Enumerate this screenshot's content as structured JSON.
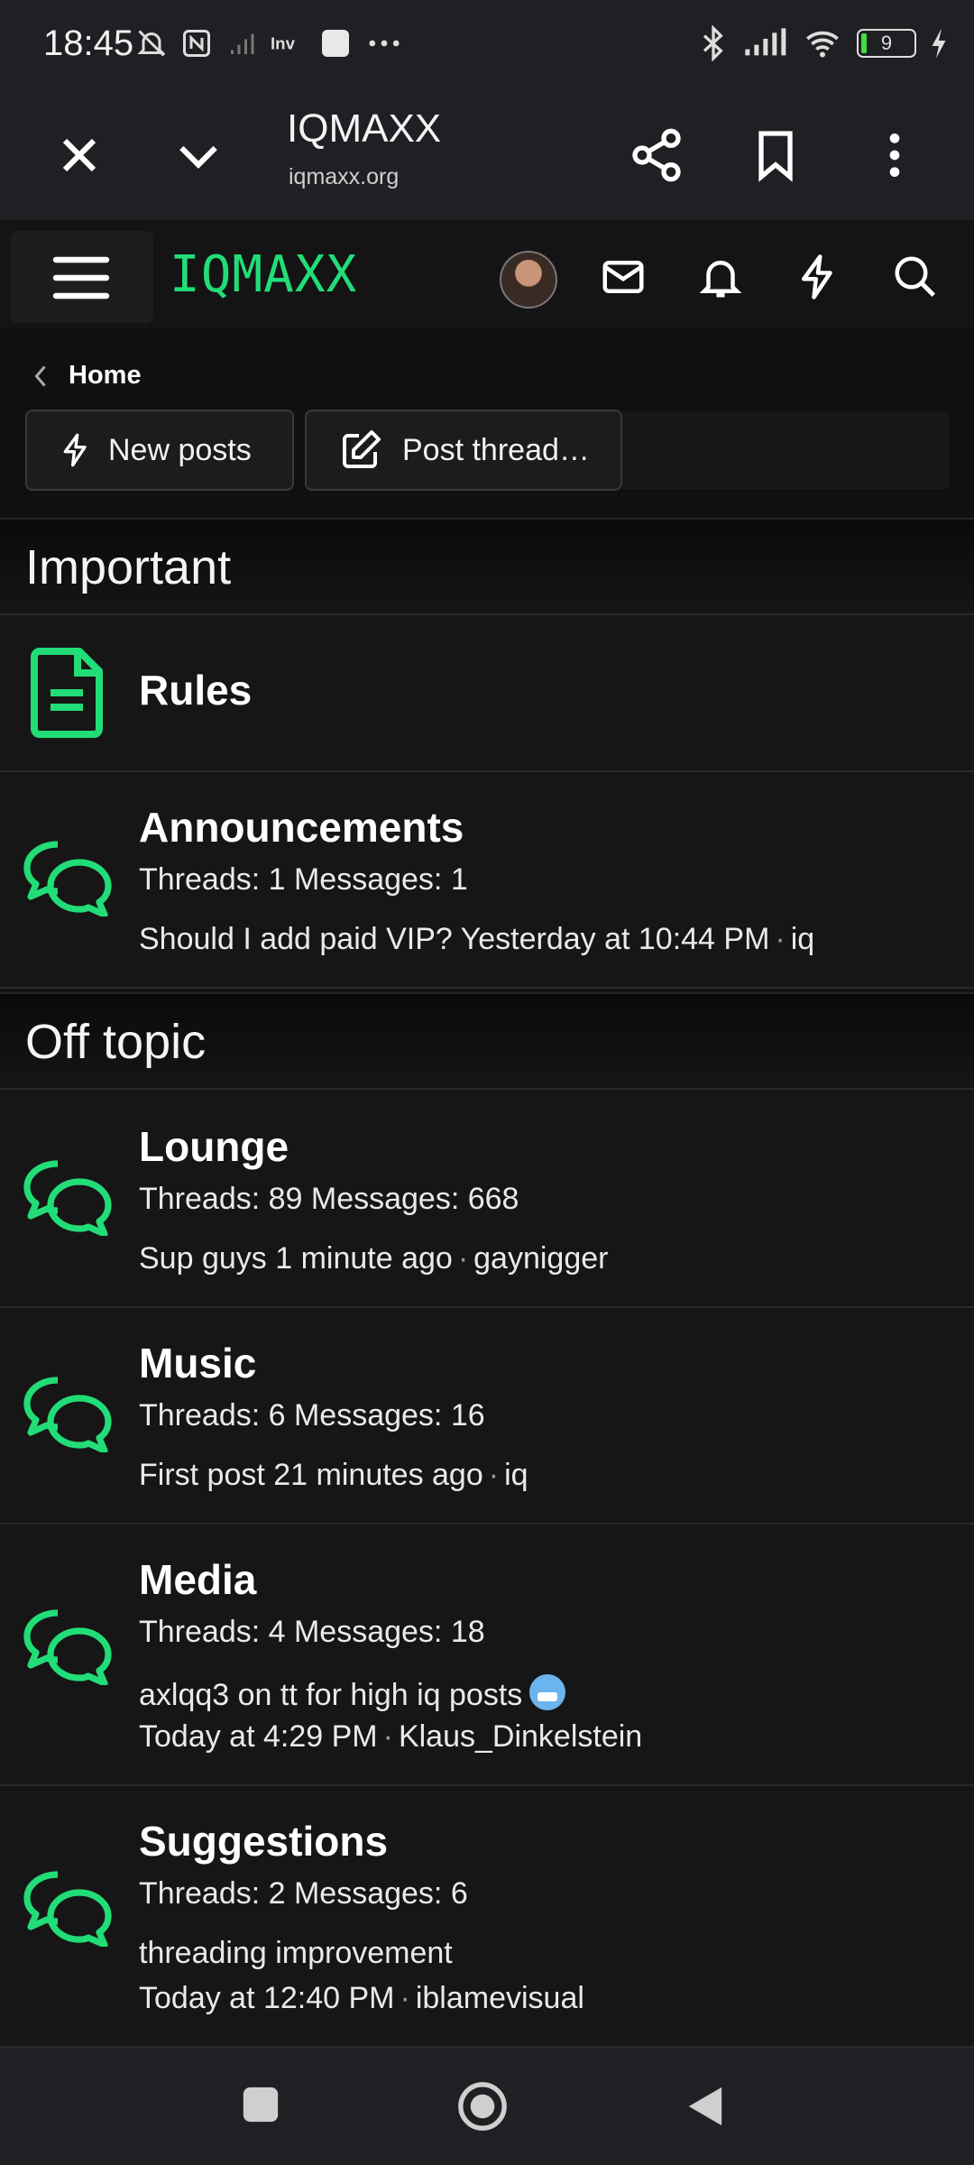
{
  "status_bar": {
    "time": "18:45",
    "battery": "9"
  },
  "browser": {
    "title": "IQMAXX",
    "url": "iqmaxx.org"
  },
  "site": {
    "logo": "IQMAXX",
    "accent": "#22dd77"
  },
  "breadcrumb": {
    "label": "Home"
  },
  "actions": {
    "new_posts": "New posts",
    "post_thread": "Post thread…"
  },
  "sections": [
    {
      "title": "Important",
      "forums": [
        {
          "name": "Rules",
          "icon": "document-icon"
        },
        {
          "name": "Announcements",
          "icon": "chat-bubbles-icon",
          "stats": "Threads: 1 Messages: 1",
          "last_title": "Should I add paid VIP?",
          "last_time": "Yesterday at 10:44 PM",
          "last_user": "iq"
        }
      ]
    },
    {
      "title": "Off topic",
      "forums": [
        {
          "name": "Lounge",
          "icon": "chat-bubbles-icon",
          "stats": "Threads: 89 Messages: 668",
          "last_title": "Sup guys",
          "last_time": "1 minute ago",
          "last_user": "gaynigger"
        },
        {
          "name": "Music",
          "icon": "chat-bubbles-icon",
          "stats": "Threads: 6 Messages: 16",
          "last_title": "First post",
          "last_time": "21 minutes ago",
          "last_user": "iq"
        },
        {
          "name": "Media",
          "icon": "chat-bubbles-icon",
          "stats": "Threads: 4 Messages: 18",
          "last_title": "axlqq3 on tt for high iq posts",
          "last_time": "Today at 4:29 PM",
          "last_user": "Klaus_Dinkelstein"
        },
        {
          "name": "Suggestions",
          "icon": "chat-bubbles-icon",
          "stats": "Threads: 2 Messages: 6",
          "last_title": "threading improvement",
          "last_time": "Today at 12:40 PM",
          "last_user": "iblamevisual"
        }
      ]
    }
  ]
}
